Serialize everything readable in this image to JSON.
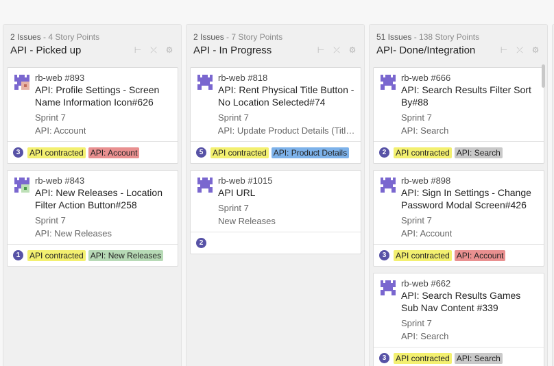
{
  "colors": {
    "points_bg": "#5752a6",
    "label_contracted": "#f3f070",
    "label_account": "#e99090",
    "label_new_releases": "#b7dab6",
    "label_product_details": "#7db2ea",
    "label_search": "#c9c9c9"
  },
  "icons": {
    "sprint": "milestone-icon",
    "epic": "document-icon",
    "header_actions": [
      "collapse-icon",
      "expand-icon",
      "gear-icon"
    ]
  },
  "columns": [
    {
      "issues": "2 Issues",
      "points": "4 Story Points",
      "title": "API - Picked up",
      "cards": [
        {
          "repo": "rb-web #893",
          "title": "API: Profile Settings - Screen Name Information Icon#626",
          "sprint": "Sprint 7",
          "epic": "API: Account",
          "points": "3",
          "labels": [
            "API contracted",
            "API: Account"
          ]
        },
        {
          "repo": "rb-web #843",
          "title": "API: New Releases - Location Filter Action Button#258",
          "sprint": "Sprint 7",
          "epic": "API: New Releases",
          "points": "1",
          "labels": [
            "API contracted",
            "API: New Releases"
          ]
        }
      ]
    },
    {
      "issues": "2 Issues",
      "points": "7 Story Points",
      "title": "API - In Progress",
      "cards": [
        {
          "repo": "rb-web #818",
          "title": "API: Rent Physical Title Button - No Location Selected#74",
          "sprint": "Sprint 7",
          "epic": "API: Update Product Details (Title...",
          "points": "5",
          "labels": [
            "API contracted",
            "API: Product Details"
          ]
        },
        {
          "repo": "rb-web #1015",
          "title": "API URL",
          "sprint": "Sprint 7",
          "epic": "New Releases",
          "points": "2",
          "labels": []
        }
      ]
    },
    {
      "issues": "51 Issues",
      "points": "138 Story Points",
      "title": "API- Done/Integration",
      "cards": [
        {
          "repo": "rb-web #666",
          "title": "API: Search Results Filter Sort By#88",
          "sprint": "Sprint 7",
          "epic": "API: Search",
          "points": "2",
          "labels": [
            "API contracted",
            "API: Search"
          ]
        },
        {
          "repo": "rb-web #898",
          "title": "API: Sign In Settings - Change Password Modal Screen#426",
          "sprint": "Sprint 7",
          "epic": "API: Account",
          "points": "3",
          "labels": [
            "API contracted",
            "API: Account"
          ]
        },
        {
          "repo": "rb-web #662",
          "title": "API: Search Results Games Sub Nav Content #339",
          "sprint": "Sprint 7",
          "epic": "API: Search",
          "points": "3",
          "labels": [
            "API contracted",
            "API: Search"
          ]
        }
      ]
    }
  ]
}
